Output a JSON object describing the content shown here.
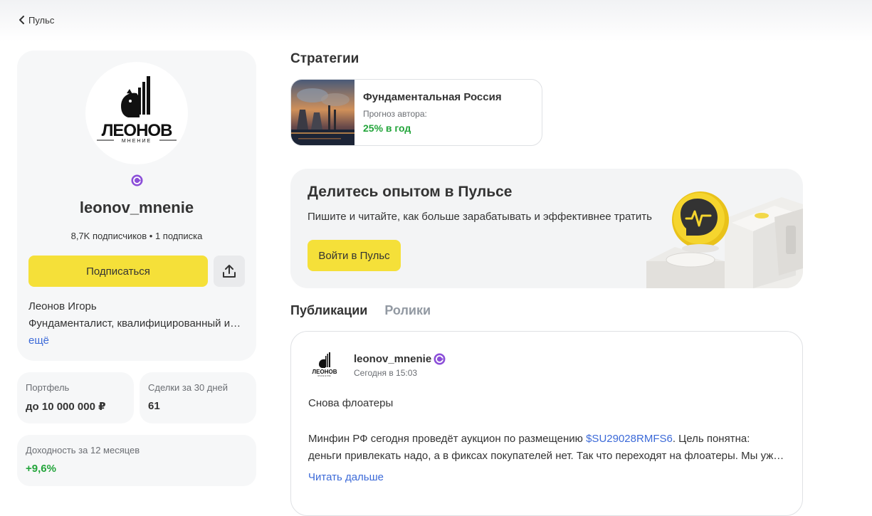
{
  "nav": {
    "back_label": "Пульс"
  },
  "profile": {
    "logo_main": "ЛЕОНОВ",
    "logo_sub": "МНЕНИЕ",
    "username": "leonov_mnenie",
    "stats": "8,7K подписчиков • 1 подписка",
    "subscribe_label": "Подписаться",
    "author_name": "Леонов Игорь",
    "bio": "Фундаменталист, квалифицированный инвестор",
    "more_label": "ещё"
  },
  "stats": [
    {
      "label": "Портфель",
      "value": "до 10 000 000 ₽"
    },
    {
      "label": "Сделки за 30 дней",
      "value": "61"
    },
    {
      "label": "Доходность за 12 месяцев",
      "value": "+9,6%"
    }
  ],
  "strategies": {
    "title": "Стратегии",
    "items": [
      {
        "name": "Фундаментальная Россия",
        "forecast_label": "Прогноз автора:",
        "forecast_value": "25% в год"
      }
    ]
  },
  "promo": {
    "title": "Делитесь опытом в Пульсе",
    "text": "Пишите и читайте, как больше зарабатывать и эффективнее тратить",
    "button_label": "Войти в Пульс"
  },
  "tabs": [
    {
      "label": "Публикации"
    },
    {
      "label": "Ролики"
    }
  ],
  "post": {
    "author": "leonov_mnenie",
    "time": "Сегодня в 15:03",
    "heading": "Снова флоатеры",
    "body_before": "Минфин РФ сегодня проведёт аукцион по размещению ",
    "ticker": "$SU29028RMFS6",
    "body_after": ". Цель понятна:",
    "body_line2": "деньги привлекать надо, а в фиксах покупателей нет. Так что переходят на флоатеры. Мы уже видим, как",
    "read_more": "Читать дальше"
  },
  "colors": {
    "accent_yellow": "#f5e039",
    "link_blue": "#3c6ad8",
    "positive_green": "#23a53b",
    "verified_purple": "#8b4ed8"
  }
}
